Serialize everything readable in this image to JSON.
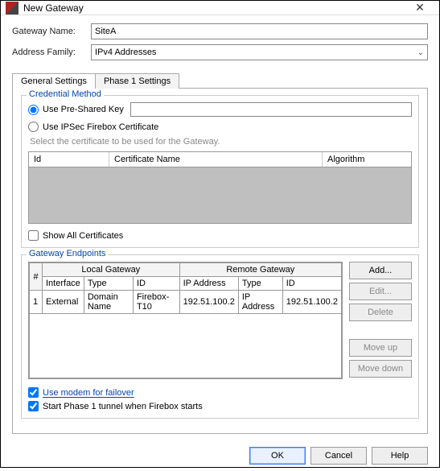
{
  "window": {
    "title": "New Gateway"
  },
  "form": {
    "name_label": "Gateway Name:",
    "name_value": "SiteA",
    "family_label": "Address Family:",
    "family_value": "IPv4 Addresses"
  },
  "tabs": {
    "general": "General Settings",
    "phase1": "Phase 1 Settings"
  },
  "cred": {
    "legend": "Credential Method",
    "psk": "Use Pre-Shared Key",
    "psk_value": "",
    "cert": "Use IPSec Firebox Certificate",
    "hint": "Select the certificate to be used for the Gateway.",
    "cols": {
      "id": "Id",
      "name": "Certificate Name",
      "alg": "Algorithm"
    },
    "showall": "Show All Certificates"
  },
  "ep": {
    "legend": "Gateway Endpoints",
    "head": {
      "num": "#",
      "local": "Local Gateway",
      "remote": "Remote Gateway"
    },
    "sub": {
      "iface": "Interface",
      "type": "Type",
      "id": "ID",
      "ip": "IP Address",
      "rtype": "Type",
      "rid": "ID"
    },
    "rows": [
      {
        "num": "1",
        "iface": "External",
        "type": "Domain Name",
        "id": "Firebox-T10",
        "ip": "192.51.100.2",
        "rtype": "IP Address",
        "rid": "192.51.100.2"
      }
    ],
    "buttons": {
      "add": "Add...",
      "edit": "Edit...",
      "delete": "Delete",
      "moveup": "Move up",
      "movedown": "Move down"
    }
  },
  "opts": {
    "modem": "Use modem for failover",
    "start": "Start Phase 1 tunnel when Firebox starts"
  },
  "footer": {
    "ok": "OK",
    "cancel": "Cancel",
    "help": "Help"
  }
}
